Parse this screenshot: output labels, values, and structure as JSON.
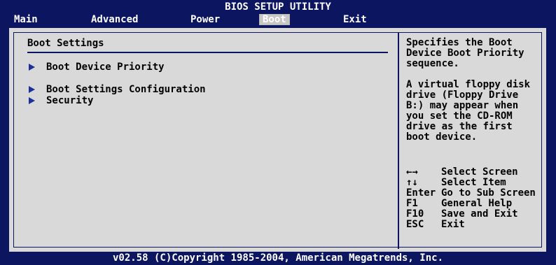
{
  "header": {
    "title": "BIOS SETUP UTILITY",
    "tabs": [
      {
        "label": "Main"
      },
      {
        "label": "Advanced"
      },
      {
        "label": "Power"
      },
      {
        "label": "Boot",
        "active": true
      },
      {
        "label": "Exit"
      }
    ]
  },
  "boot": {
    "section_title": "Boot Settings",
    "items": [
      {
        "label": "Boot Device Priority"
      },
      {
        "label": "Boot Settings Configuration"
      },
      {
        "label": "Security"
      }
    ]
  },
  "help": {
    "text": "Specifies the Boot\nDevice Boot Priority\nsequence.\n\nA virtual floppy disk\ndrive (Floppy Drive\nB:) may appear when\nyou set the CD-ROM\ndrive as the first\nboot device.",
    "keys": [
      {
        "key": "←→",
        "desc": "Select Screen"
      },
      {
        "key": "↑↓",
        "desc": "Select Item"
      },
      {
        "key": "Enter",
        "desc": "Go to Sub Screen"
      },
      {
        "key": "F1",
        "desc": "General Help"
      },
      {
        "key": "F10",
        "desc": "Save and Exit"
      },
      {
        "key": "ESC",
        "desc": "Exit"
      }
    ]
  },
  "footer": {
    "text": "v02.58 (C)Copyright 1985-2004, American Megatrends, Inc."
  },
  "colors": {
    "background": "#0b1560",
    "panel": "#d9d9d9",
    "arrow": "#1b2f9f",
    "text_light": "#ffffff",
    "text_dark": "#000000"
  }
}
